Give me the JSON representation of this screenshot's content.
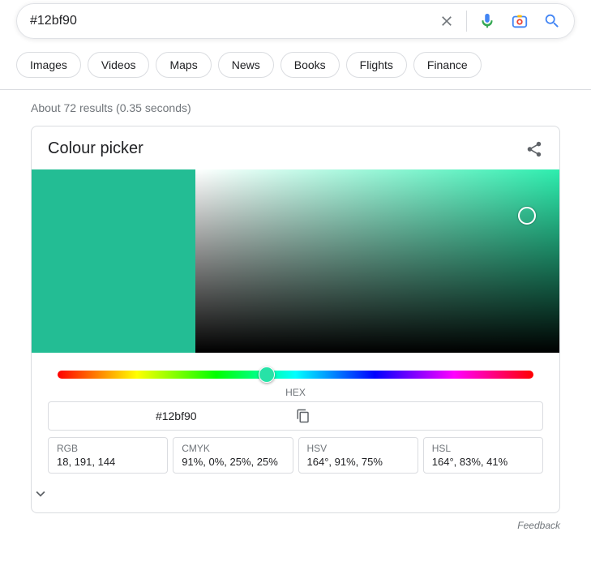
{
  "search": {
    "query": "#12bf90"
  },
  "chips": [
    "Images",
    "Videos",
    "Maps",
    "News",
    "Books",
    "Flights",
    "Finance"
  ],
  "stats": "About 72 results (0.35 seconds)",
  "card": {
    "title": "Colour picker",
    "swatch_color": "#23bd94",
    "picker_hue_base": "#2dedae",
    "circle_left": "91%",
    "circle_top": "25%",
    "hue_thumb_left": "44%",
    "hue_thumb_color": "#27e2a7",
    "hex": {
      "label": "HEX",
      "value": "#12bf90"
    },
    "formats": [
      {
        "label": "RGB",
        "value": "18, 191, 144"
      },
      {
        "label": "CMYK",
        "value": "91%, 0%, 25%, 25%"
      },
      {
        "label": "HSV",
        "value": "164°, 91%, 75%"
      },
      {
        "label": "HSL",
        "value": "164°, 83%, 41%"
      }
    ]
  },
  "feedback": "Feedback"
}
